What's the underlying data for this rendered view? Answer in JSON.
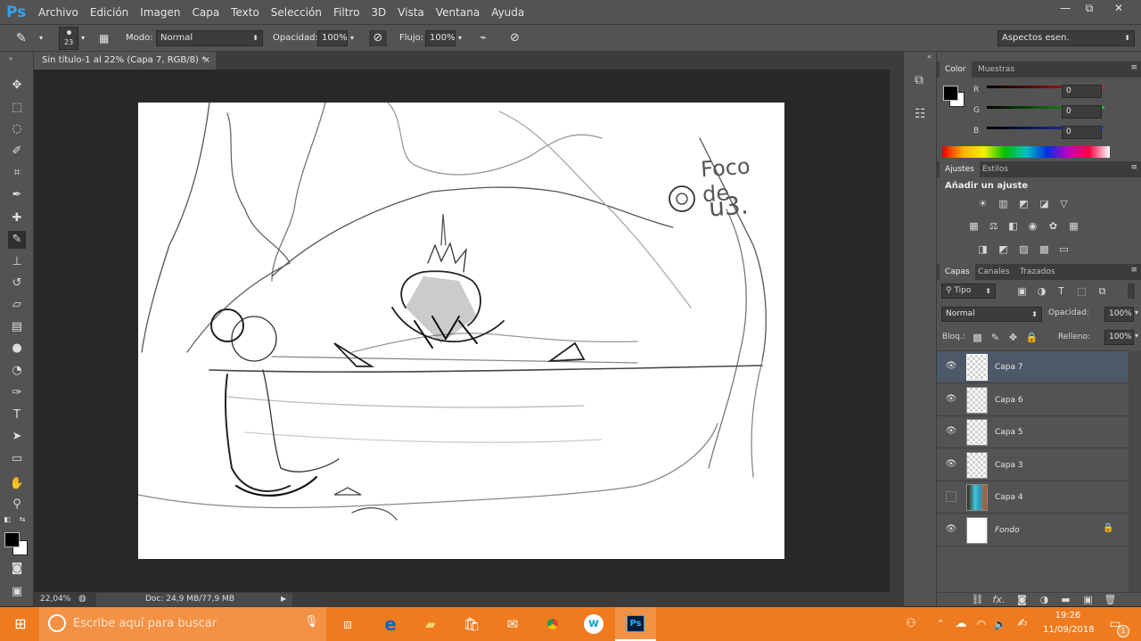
{
  "app": {
    "logo": "Ps"
  },
  "menu": [
    "Archivo",
    "Edición",
    "Imagen",
    "Capa",
    "Texto",
    "Selección",
    "Filtro",
    "3D",
    "Vista",
    "Ventana",
    "Ayuda"
  ],
  "window_controls": {
    "minimize": "—",
    "restore": "⧉",
    "close": "✕"
  },
  "options": {
    "brush_size": "23",
    "mode_label": "Modo:",
    "mode_value": "Normal",
    "opacity_label": "Opacidad:",
    "opacity_value": "100%",
    "flow_label": "Flujo:",
    "flow_value": "100%",
    "workspace": "Aspectos esen."
  },
  "document": {
    "tab_title": "Sin título-1 al 22% (Capa 7, RGB/8) *",
    "close_glyph": "×"
  },
  "status": {
    "zoom": "22,04%",
    "doc": "Doc: 24,9 MB/77,9 MB"
  },
  "color_panel": {
    "tabs": [
      "Color",
      "Muestras"
    ],
    "channels": [
      {
        "label": "R",
        "value": "0",
        "color": "#e02020"
      },
      {
        "label": "G",
        "value": "0",
        "color": "#20c020"
      },
      {
        "label": "B",
        "value": "0",
        "color": "#2040e0"
      }
    ]
  },
  "adjust_panel": {
    "tabs": [
      "Ajustes",
      "Estilos"
    ],
    "title": "Añadir un ajuste"
  },
  "layers_panel": {
    "tabs": [
      "Capas",
      "Canales",
      "Trazados"
    ],
    "filter": "Tipo",
    "blend": "Normal",
    "opacity_label": "Opacidad:",
    "opacity": "100%",
    "lock_label": "Bloq.:",
    "fill_label": "Relleno:",
    "fill": "100%",
    "layers": [
      {
        "name": "Capa 7",
        "visible": true,
        "selected": true
      },
      {
        "name": "Capa 6",
        "visible": true,
        "selected": false
      },
      {
        "name": "Capa 5",
        "visible": true,
        "selected": false
      },
      {
        "name": "Capa 3",
        "visible": true,
        "selected": false
      },
      {
        "name": "Capa 4",
        "visible": false,
        "selected": false
      },
      {
        "name": "Fondo",
        "visible": true,
        "selected": false
      }
    ],
    "footer_fx": "fx."
  },
  "canvas_text": {
    "note_line1": "Foco de",
    "note_line2": "u3."
  },
  "taskbar": {
    "search_placeholder": "Escribe aquí para buscar",
    "time": "19:26",
    "date": "11/09/2018",
    "notif_count": "1"
  }
}
